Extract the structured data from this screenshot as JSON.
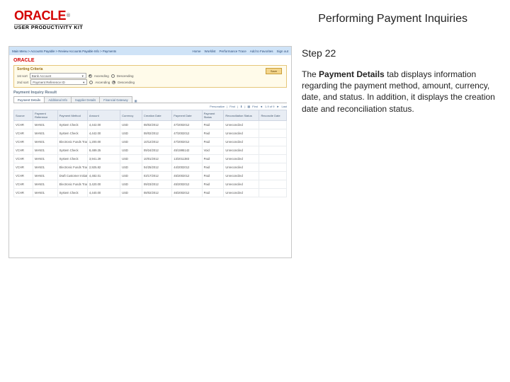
{
  "header": {
    "logo_text": "ORACLE",
    "logo_tm": "®",
    "upk": "USER PRODUCTIVITY KIT",
    "title": "Performing Payment Inquiries"
  },
  "step": "Step 22",
  "desc_before": "The ",
  "desc_bold": "Payment Details",
  "desc_after": " tab displays information regarding the payment method, amount, currency, date, and status. In addition, it displays the creation date and reconciliation status.",
  "screenshot": {
    "breadcrumb": "Main Menu > Accounts Payable > Review Accounts Payable Info > Payments",
    "toplinks": [
      "Home",
      "Worklist",
      "Performance Trace",
      "Add to Favorites",
      "Sign out"
    ],
    "oracle": "ORACLE",
    "sort_title": "Sorting Criteria",
    "sort_1st_label": "1st sort",
    "sort_2nd_label": "2nd sort",
    "sort_sel1": "Bank Account",
    "sort_sel2": "Payment Reference ID",
    "asc": "Ascending",
    "desc": "Descending",
    "save": "Save",
    "section": "Payment Inquiry Result",
    "tabs": [
      "Payment Details",
      "Additional Info",
      "Supplier Details",
      "Financial Gateway"
    ],
    "extra_tab": "",
    "controls": {
      "personalize": "Personalize",
      "find": "Find",
      "page": "1-9 of 9",
      "first": "First",
      "last": "Last"
    },
    "cols": [
      "Source",
      "Payment Reference",
      "Payment Method",
      "Amount",
      "Currency",
      "Creation Date",
      "Payment Date",
      "Payment Status",
      "Reconciliation Status",
      "Reconcile Date"
    ],
    "chart_data": {
      "type": "table",
      "title": "Payment Inquiry Result",
      "columns": [
        "Source",
        "Payment Reference",
        "Payment Method",
        "Amount",
        "Currency",
        "Creation Date",
        "Payment Date",
        "Payment Status",
        "Reconciliation Status",
        "Reconcile Date"
      ],
      "rows": [
        [
          "VCHR",
          "MAN01",
          "System Check",
          "4,442.00",
          "USD",
          "08/02/2012",
          "47/2002012",
          "Paid",
          "Unreconciled",
          ""
        ],
        [
          "VCHR",
          "MAN01",
          "System Check",
          "4,442.00",
          "USD",
          "08/02/2012",
          "47/2002012",
          "Paid",
          "Unreconciled",
          ""
        ],
        [
          "VCHR",
          "MAN01",
          "Electronic Funds Transfer",
          "1,200.00",
          "USD",
          "10/12/2012",
          "47/2002012",
          "Paid",
          "Unreconciled",
          ""
        ],
        [
          "VCHR",
          "MAN01",
          "System Check",
          "8,489.25",
          "USD",
          "09/24/2012",
          "45/1995142",
          "Void",
          "Unreconciled",
          ""
        ],
        [
          "VCHR",
          "MAN01",
          "System Check",
          "3,941.29",
          "USD",
          "10/01/2012",
          "13/2011383",
          "Paid",
          "Unreconciled",
          ""
        ],
        [
          "VCHR",
          "MAN01",
          "Electronic Funds Transfer",
          "2,925.82",
          "USD",
          "04/25/2012",
          "44/2002012",
          "Paid",
          "Unreconciled",
          ""
        ],
        [
          "VCHR",
          "MAN01",
          "Draft Customer Initiated",
          "4,482.01",
          "USD",
          "03/17/2012",
          "45/2002012",
          "Paid",
          "Unreconciled",
          ""
        ],
        [
          "VCHR",
          "MAN01",
          "Electronic Funds Transfer",
          "3,420.00",
          "USD",
          "09/23/2012",
          "45/2002012",
          "Paid",
          "Unreconciled",
          ""
        ],
        [
          "VCHR",
          "MAN01",
          "System Check",
          "4,440.00",
          "USD",
          "08/02/2012",
          "46/2002012",
          "Paid",
          "Unreconciled",
          ""
        ]
      ]
    }
  }
}
